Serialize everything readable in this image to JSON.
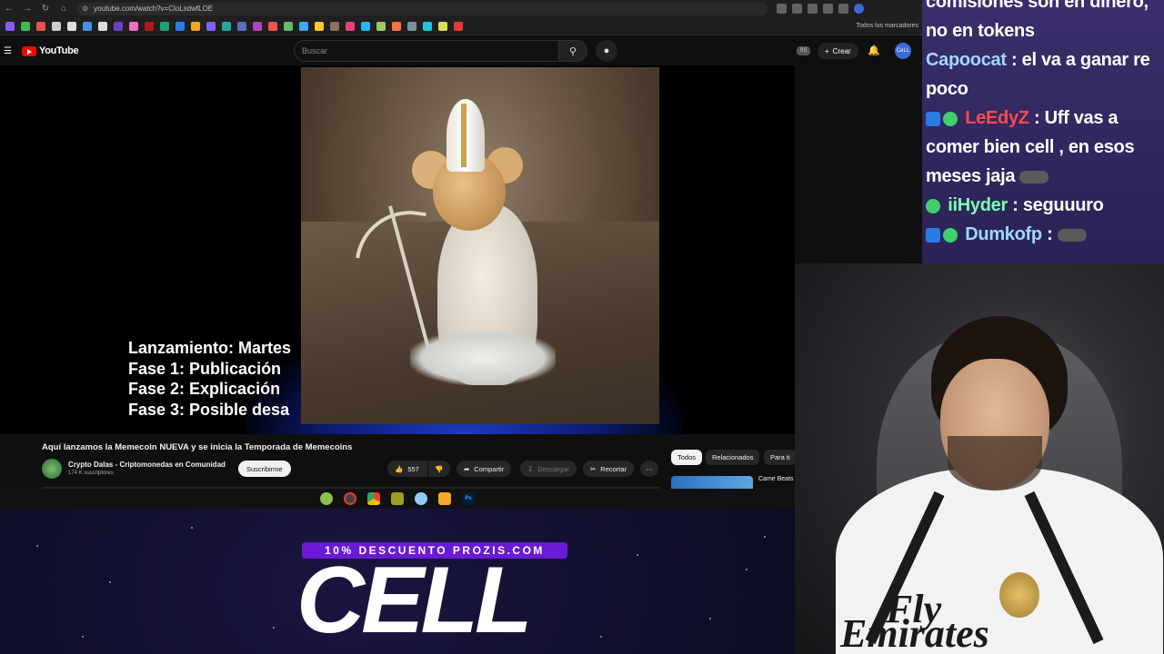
{
  "browser": {
    "url": "youtube.com/watch?v=CloLsdwfLOE",
    "bookmarks_all": "Todos los marcadores"
  },
  "youtube": {
    "logo": "YouTube",
    "search_placeholder": "Buscar",
    "ss_badge": "SS",
    "create_label": "Crear",
    "avatar_label": "CeLL"
  },
  "video": {
    "caption_lines": [
      "Lanzamiento: Martes",
      "Fase 1: Publicación",
      "Fase 2: Explicación",
      "Fase 3: Posible desa"
    ],
    "title": "Aquí lanzamos la Memecoin NUEVA y se inicia la Temporada de Memecoins",
    "channel": "Crypto Dalas - Criptomonedas en Comunidad",
    "subscribers": "174 K suscriptores",
    "subscribe_label": "Suscribirme",
    "likes": "557",
    "share_label": "Compartir",
    "download_label": "Descargar",
    "clip_label": "Recortar"
  },
  "sidebar": {
    "chips": [
      "Todos",
      "Relacionados",
      "Para ti"
    ],
    "recommendation_title": "Came Beats Prettyyyd..."
  },
  "chat": {
    "messages": [
      {
        "user": "",
        "text": "comisiones son en dinero, no en tokens"
      },
      {
        "user": "Capoocat",
        "text": ": el va a ganar re poco"
      },
      {
        "user": "LeEdyZ",
        "text": ": Uff vas a comer bien cell , en esos meses jaja"
      },
      {
        "user": "iiHyder",
        "text": ": seguuuro"
      },
      {
        "user": "Dumkofp",
        "text": ":"
      }
    ]
  },
  "overlay": {
    "promo": "10% DESCUENTO PROZIS.COM",
    "brand": "CELL"
  },
  "webcam": {
    "shirt_line1": "Fly",
    "shirt_line2": "Emirates"
  },
  "colors": {
    "youtube_red": "#ff0000",
    "chat_bg": "#3b2e6b",
    "promo_purple": "#6a1ad6"
  }
}
